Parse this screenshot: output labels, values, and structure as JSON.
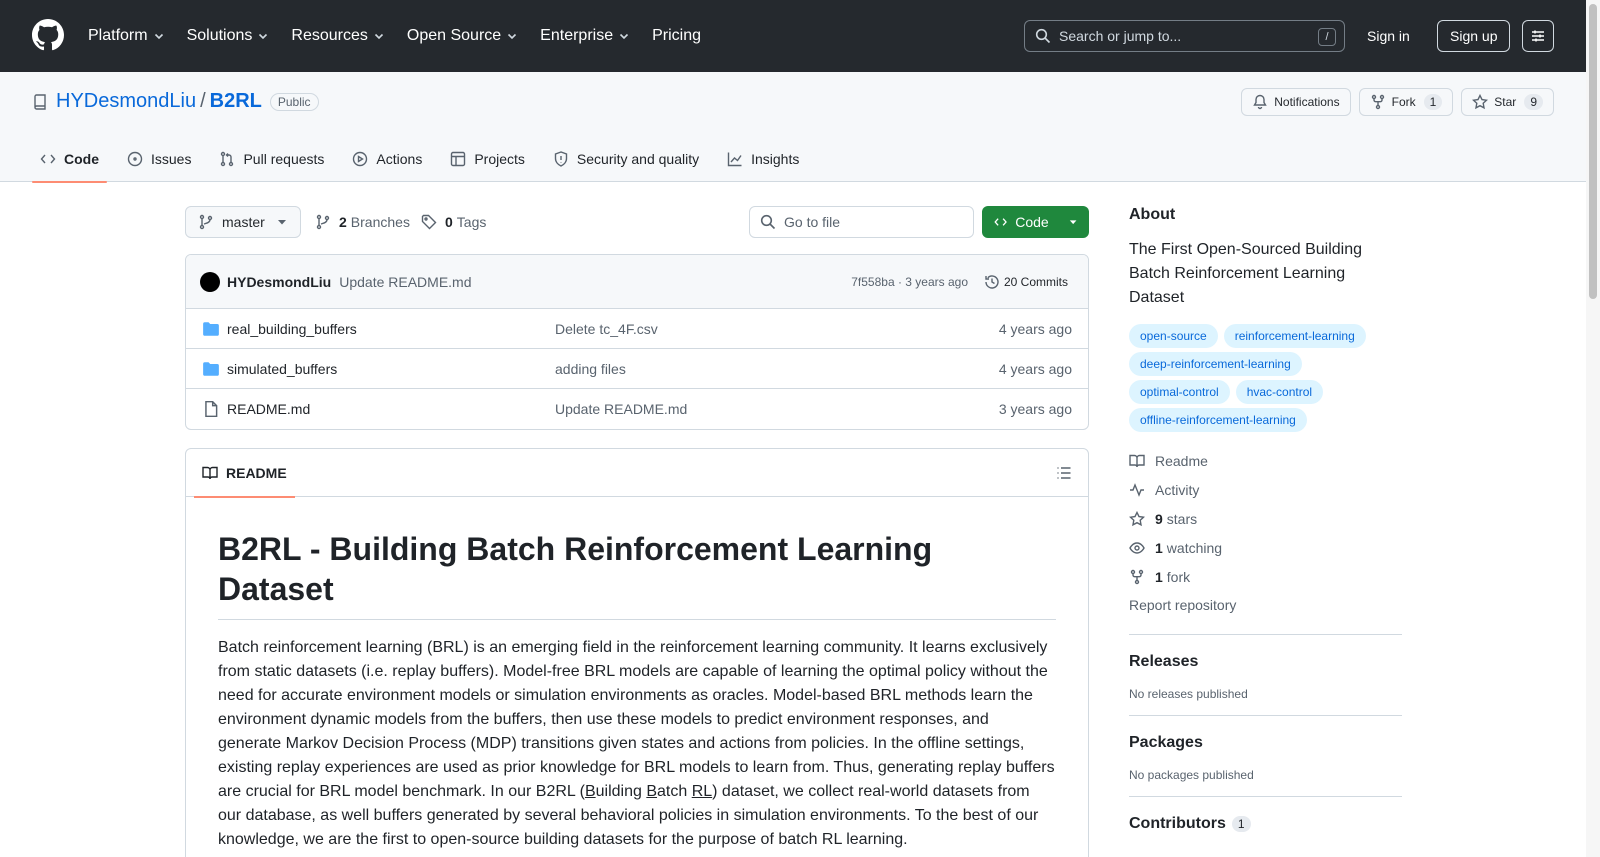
{
  "header": {
    "nav": [
      {
        "label": "Platform",
        "dropdown": true
      },
      {
        "label": "Solutions",
        "dropdown": true
      },
      {
        "label": "Resources",
        "dropdown": true
      },
      {
        "label": "Open Source",
        "dropdown": true
      },
      {
        "label": "Enterprise",
        "dropdown": true
      },
      {
        "label": "Pricing",
        "dropdown": false
      }
    ],
    "search_placeholder": "Search or jump to...",
    "search_shortcut": "/",
    "signin": "Sign in",
    "signup": "Sign up"
  },
  "repo": {
    "owner": "HYDesmondLiu",
    "separator": "/",
    "name": "B2RL",
    "visibility": "Public",
    "notifications": "Notifications",
    "fork_label": "Fork",
    "fork_count": "1",
    "star_label": "Star",
    "star_count": "9"
  },
  "tabs": [
    {
      "label": "Code",
      "icon": "code-icon",
      "active": true
    },
    {
      "label": "Issues",
      "icon": "issue-icon"
    },
    {
      "label": "Pull requests",
      "icon": "pull-request-icon"
    },
    {
      "label": "Actions",
      "icon": "play-icon"
    },
    {
      "label": "Projects",
      "icon": "table-icon"
    },
    {
      "label": "Security and quality",
      "icon": "shield-icon"
    },
    {
      "label": "Insights",
      "icon": "graph-icon"
    }
  ],
  "toolbar": {
    "branch": "master",
    "branches_count": "2",
    "branches_label": "Branches",
    "tags_count": "0",
    "tags_label": "Tags",
    "goto_placeholder": "Go to file",
    "code_label": "Code"
  },
  "latest_commit": {
    "author": "HYDesmondLiu",
    "message": "Update README.md",
    "meta": "7f558ba · 3 years ago",
    "commits": "20 Commits"
  },
  "files": [
    {
      "name": "real_building_buffers",
      "type": "folder",
      "message": "Delete tc_4F.csv",
      "time": "4 years ago"
    },
    {
      "name": "simulated_buffers",
      "type": "folder",
      "message": "adding files",
      "time": "4 years ago"
    },
    {
      "name": "README.md",
      "type": "file",
      "message": "Update README.md",
      "time": "3 years ago"
    }
  ],
  "readme": {
    "tab": "README",
    "title": "B2RL - Building Batch Reinforcement Learning Dataset",
    "p1": "Batch reinforcement learning (BRL) is an emerging field in the reinforcement learning community. It learns exclusively from static datasets (i.e. replay buffers). Model-free BRL models are capable of learning the optimal policy without the need for accurate environment models or simulation environments as oracles. Model-based BRL methods learn the environment dynamic models from the buffers, then use these models to predict environment responses, and generate Markov Decision Process (MDP) transitions given states and actions from policies. In the offline settings, existing replay experiences are used as prior knowledge for BRL models to learn from. Thus, generating replay buffers are crucial for BRL model benchmark. In our B2RL (",
    "b_letter": "B",
    "uilding": "uilding ",
    "b2_letter": "B",
    "atch": "atch ",
    "rl": "RL",
    "p1_end": ") dataset, we collect real-world datasets from our database, as well buffers generated by several behavioral policies in simulation environments. To the best of our knowledge, we are the first to open-source building datasets for the purpose of batch RL learning."
  },
  "about": {
    "title": "About",
    "description": "The First Open-Sourced Building Batch Reinforcement Learning Dataset",
    "topics": [
      "open-source",
      "reinforcement-learning",
      "deep-reinforcement-learning",
      "optimal-control",
      "hvac-control",
      "offline-reinforcement-learning"
    ],
    "readme": "Readme",
    "activity": "Activity",
    "stars_count": "9",
    "stars_label": "stars",
    "watching_count": "1",
    "watching_label": "watching",
    "fork_count": "1",
    "fork_label": "fork",
    "report": "Report repository"
  },
  "releases": {
    "title": "Releases",
    "empty": "No releases published"
  },
  "packages": {
    "title": "Packages",
    "empty": "No packages published"
  },
  "contributors": {
    "title": "Contributors",
    "count": "1"
  },
  "colors": {
    "header_bg": "#25292e",
    "link": "#0969da",
    "green": "#1f883d",
    "tab_underline": "#fd8c73"
  }
}
